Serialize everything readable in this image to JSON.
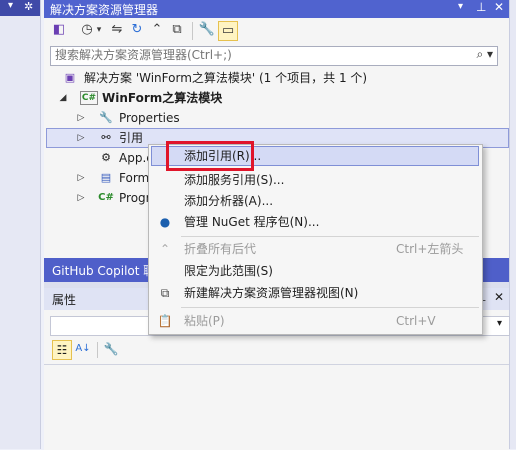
{
  "solution_explorer": {
    "title": "解决方案资源管理器",
    "search_placeholder": "搜索解决方案资源管理器(Ctrl+;)",
    "tree": {
      "solution": "解决方案 'WinForm之算法模块' (1 个项目，共 1 个)",
      "project": "WinForm之算法模块",
      "properties": "Properties",
      "references": "引用",
      "app_config": "App.c",
      "form": "Form",
      "program": "Progr"
    }
  },
  "github_copilot": {
    "label": "GitHub Copilot 聊"
  },
  "properties_panel": {
    "title": "属性"
  },
  "context_menu": {
    "add_reference": "添加引用(R)...",
    "add_service_reference": "添加服务引用(S)...",
    "add_analyzer": "添加分析器(A)...",
    "manage_nuget": "管理 NuGet 程序包(N)...",
    "collapse_all": "折叠所有后代",
    "collapse_all_shortcut": "Ctrl+左箭头",
    "scope_to_this": "限定为此范围(S)",
    "new_view": "新建解决方案资源管理器视图(N)",
    "paste": "粘贴(P)",
    "paste_shortcut": "Ctrl+V"
  },
  "colors": {
    "title_bar": "#5063cf",
    "highlight_box": "#e0152a"
  }
}
